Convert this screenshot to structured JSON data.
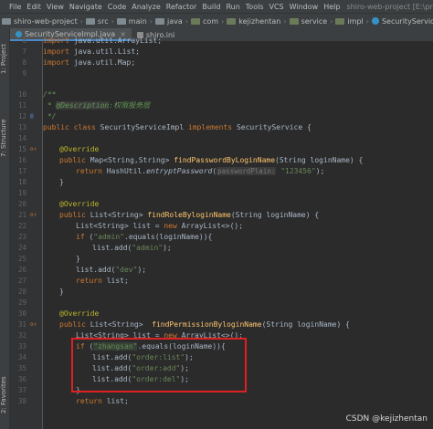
{
  "menubar": {
    "items": [
      "File",
      "Edit",
      "View",
      "Navigate",
      "Code",
      "Analyze",
      "Refactor",
      "Build",
      "Run",
      "Tools",
      "VCS",
      "Window",
      "Help"
    ],
    "window_title": "shiro-web-project [E:\\project\\shiro-web"
  },
  "breadcrumb": [
    "shiro-web-project",
    "src",
    "main",
    "java",
    "com",
    "kejizhentan",
    "service",
    "impl",
    "SecurityServiceImpl"
  ],
  "tabs": [
    {
      "label": "SecurityServiceImpl.java"
    },
    {
      "label": "shiro.ini"
    }
  ],
  "side_tabs": {
    "project": "1: Project",
    "structure": "7: Structure",
    "favorites": "2: Favorites"
  },
  "code": {
    "l1": "import java.util.ArrayList;",
    "l2": "import java.util.List;",
    "l3": "import java.util.Map;",
    "l5": "/**",
    "l6_star": " * ",
    "l6_tag": "@Description",
    "l6_colon": ":",
    "l6_text": "权限服务层",
    "l7": " */",
    "l8_kw1": "public class ",
    "l8_name": "SecurityServiceImpl ",
    "l8_kw2": "implements ",
    "l8_iface": "SecurityService {",
    "override": "@Override",
    "l11_kw": "public ",
    "l11_type": "Map<String,String> ",
    "l11_fn": "findPasswordByLoginName",
    "l11_rest": "(String loginName) {",
    "l12_kw": "return ",
    "l12_cls": "HashUtil.",
    "l12_fn": "entryptPassword",
    "l12_paren": "(",
    "l12_hint": "passwordPlain:",
    "l12_str": " \"123456\"",
    "l12_end": ");",
    "close": "}",
    "l16_kw": "public ",
    "l16_type": "List<String> ",
    "l16_fn": "findRoleByloginName",
    "l16_rest": "(String loginName) {",
    "l17_a": "List<String> list = ",
    "l17_kw": "new ",
    "l17_b": "ArrayList<>();",
    "l18_kw": "if ",
    "l18_p": "(",
    "l18_str": "\"admin\"",
    "l18_rest": ".equals(loginName)){",
    "l19_a": "list.add(",
    "l19_str": "\"admin\"",
    "l19_b": ");",
    "l21_a": "list.add(",
    "l21_str": "\"dev\"",
    "l21_b": ");",
    "l22_kw": "return ",
    "l22_rest": "list;",
    "l26_kw": "public ",
    "l26_type": "List<String>  ",
    "l26_fn": "findPermissionByloginName",
    "l26_rest": "(String loginName) {",
    "l27_a": "List<String> list = ",
    "l27_kw": "new ",
    "l27_b": "ArrayList<>();",
    "l28_kw": "if ",
    "l28_p": "(",
    "l28_str": "\"zhangsan\"",
    "l28_rest": ".equals(loginName)){",
    "l29_a": "list.add(",
    "l29_str": "\"order:list\"",
    "l29_b": ");",
    "l30_a": "list.add(",
    "l30_str": "\"order:add\"",
    "l30_b": ");",
    "l31_a": "list.add(",
    "l31_str": "\"order:del\"",
    "l31_b": ");",
    "l33_kw": "return ",
    "l33_rest": "list;"
  },
  "line_numbers": [
    "6",
    "7",
    "8",
    "9",
    "10",
    "11",
    "12",
    "13",
    "14",
    "15",
    "16",
    "17",
    "18",
    "19",
    "20",
    "21",
    "22",
    "23",
    "24",
    "25",
    "26",
    "27",
    "28",
    "29",
    "30",
    "31",
    "32",
    "33",
    "34",
    "35",
    "36",
    "37",
    "38"
  ],
  "gutter_marks": {
    "override": "o↑",
    "implements": "@"
  },
  "watermark": "CSDN @kejizhentan",
  "colors": {
    "background": "#2b2b2b",
    "keyword": "#cc7832",
    "string": "#6a8759",
    "annotation": "#bbb529",
    "method": "#ffc66d",
    "highlight_box": "#e02020"
  }
}
